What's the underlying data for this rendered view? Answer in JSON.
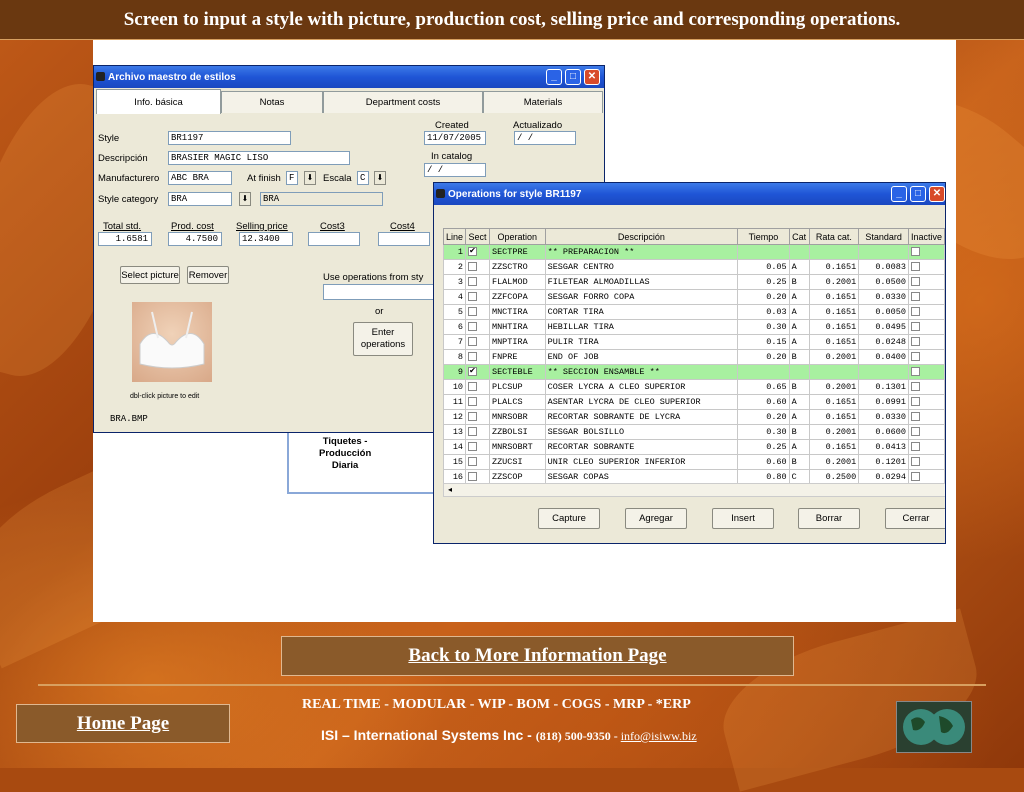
{
  "slide_title": "Screen to input a style with picture, production cost, selling price  and corresponding operations.",
  "style_window": {
    "title": "Archivo maestro de estilos",
    "tabs": [
      "Info. básica",
      "Notas",
      "Department costs",
      "Materials"
    ],
    "labels": {
      "style": "Style",
      "descripcion": "Descripción",
      "manufacturero": "Manufacturero",
      "at_finish": "At finish",
      "escala": "Escala",
      "style_category": "Style category",
      "created": "Created",
      "actualizado": "Actualizado",
      "in_catalog": "In catalog",
      "total_std": "Total std.",
      "prod_cost": "Prod. cost",
      "selling_price": "Selling price",
      "cost3": "Cost3",
      "cost4": "Cost4",
      "use_ops": "Use operations from sty",
      "or": "or",
      "dbl_click": "dbl-click picture to edit",
      "tiquetes": "Tiquetes -\nProducción\nDiaria"
    },
    "values": {
      "style": "BR1197",
      "descripcion": "BRASIER MAGIC LISO",
      "manufacturero": "ABC BRA",
      "at_finish": "F",
      "escala": "C",
      "style_category": "BRA",
      "style_category_desc": "BRA",
      "created": "11/07/2005",
      "actualizado": "  /  /",
      "in_catalog": "  /  /",
      "total_std": "1.6581",
      "prod_cost": "4.7500",
      "selling_price": "12.3400",
      "picture_file": "BRA.BMP"
    },
    "buttons": {
      "select_picture": "Select picture",
      "remover": "Remover",
      "enter_ops": "Enter operations"
    }
  },
  "ops_window": {
    "title": "Operations for style BR1197",
    "columns": [
      "Line",
      "Sect",
      "Operation",
      "Descripción",
      "Tiempo",
      "Cat",
      "Rata cat.",
      "Standard",
      "Inactive"
    ],
    "rows": [
      {
        "line": "1",
        "sect": true,
        "op": "SECTPRE",
        "desc": "** PREPARACION **",
        "tiempo": "",
        "cat": "",
        "rata": "",
        "std": ""
      },
      {
        "line": "2",
        "sect": false,
        "op": "ZZSCTRO",
        "desc": "SESGAR CENTRO",
        "tiempo": "0.05",
        "cat": "A",
        "rata": "0.1651",
        "std": "0.0083"
      },
      {
        "line": "3",
        "sect": false,
        "op": "FLALMOD",
        "desc": "FILETEAR ALMOADILLAS",
        "tiempo": "0.25",
        "cat": "B",
        "rata": "0.2001",
        "std": "0.0500"
      },
      {
        "line": "4",
        "sect": false,
        "op": "ZZFCOPA",
        "desc": "SESGAR FORRO COPA",
        "tiempo": "0.20",
        "cat": "A",
        "rata": "0.1651",
        "std": "0.0330"
      },
      {
        "line": "5",
        "sect": false,
        "op": "MNCTIRA",
        "desc": "CORTAR TIRA",
        "tiempo": "0.03",
        "cat": "A",
        "rata": "0.1651",
        "std": "0.0050"
      },
      {
        "line": "6",
        "sect": false,
        "op": "MNHTIRA",
        "desc": "HEBILLAR TIRA",
        "tiempo": "0.30",
        "cat": "A",
        "rata": "0.1651",
        "std": "0.0495"
      },
      {
        "line": "7",
        "sect": false,
        "op": "MNPTIRA",
        "desc": "PULIR TIRA",
        "tiempo": "0.15",
        "cat": "A",
        "rata": "0.1651",
        "std": "0.0248"
      },
      {
        "line": "8",
        "sect": false,
        "op": "FNPRE",
        "desc": "END OF JOB",
        "tiempo": "0.20",
        "cat": "B",
        "rata": "0.2001",
        "std": "0.0400"
      },
      {
        "line": "9",
        "sect": true,
        "op": "SECTEBLE",
        "desc": "** SECCION ENSAMBLE  **",
        "tiempo": "",
        "cat": "",
        "rata": "",
        "std": ""
      },
      {
        "line": "10",
        "sect": false,
        "op": "PLCSUP",
        "desc": "COSER LYCRA A CLEO SUPERIOR",
        "tiempo": "0.65",
        "cat": "B",
        "rata": "0.2001",
        "std": "0.1301"
      },
      {
        "line": "11",
        "sect": false,
        "op": "PLALCS",
        "desc": "ASENTAR LYCRA DE CLEO SUPERIOR",
        "tiempo": "0.60",
        "cat": "A",
        "rata": "0.1651",
        "std": "0.0991"
      },
      {
        "line": "12",
        "sect": false,
        "op": "MNRSOBR",
        "desc": "RECORTAR SOBRANTE DE LYCRA",
        "tiempo": "0.20",
        "cat": "A",
        "rata": "0.1651",
        "std": "0.0330"
      },
      {
        "line": "13",
        "sect": false,
        "op": "ZZBOLSI",
        "desc": "SESGAR BOLSILLO",
        "tiempo": "0.30",
        "cat": "B",
        "rata": "0.2001",
        "std": "0.0600"
      },
      {
        "line": "14",
        "sect": false,
        "op": "MNRSOBRT",
        "desc": "RECORTAR SOBRANTE",
        "tiempo": "0.25",
        "cat": "A",
        "rata": "0.1651",
        "std": "0.0413"
      },
      {
        "line": "15",
        "sect": false,
        "op": "ZZUCSI",
        "desc": "UNIR CLEO SUPERIOR INFERIOR",
        "tiempo": "0.60",
        "cat": "B",
        "rata": "0.2001",
        "std": "0.1201"
      },
      {
        "line": "16",
        "sect": false,
        "op": "ZZSCOP",
        "desc": "SESGAR COPAS",
        "tiempo": "0.80",
        "cat": "C",
        "rata": "0.2500",
        "std": "0.0294"
      }
    ],
    "buttons": [
      "Capture",
      "Agregar",
      "Insert",
      "Borrar",
      "Cerrar"
    ]
  },
  "back_link": "Back to More Information Page",
  "home_link": "Home Page",
  "footer_line1": "REAL TIME - MODULAR - WIP - BOM - COGS - MRP - *ERP",
  "footer_company": "ISI – International Systems Inc - ",
  "footer_phone": "(818) 500-9350 - ",
  "footer_email": "info@isiww.biz",
  "colors": {
    "section_row": "#a8f0a0",
    "title_bar": "#6a3810",
    "nav_box": "#8a5a2a"
  }
}
